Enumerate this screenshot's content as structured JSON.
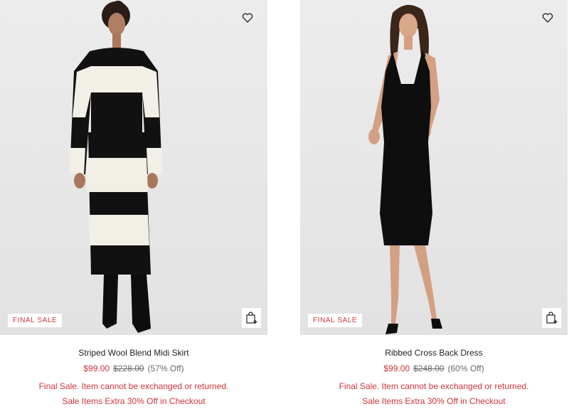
{
  "products": [
    {
      "name": "Striped Wool Blend Midi Skirt",
      "badge": "FINAL SALE",
      "sale_price": "$99.00",
      "original_price": "$228.00",
      "discount": "(57% Off)",
      "final_sale_note": "Final Sale. Item cannot be exchanged or returned.",
      "promo_note": "Sale Items Extra 30% Off in Checkout",
      "wishlist_icon": "heart-icon",
      "quick_add_icon": "shopping-bag-plus-icon"
    },
    {
      "name": "Ribbed Cross Back Dress",
      "badge": "FINAL SALE",
      "sale_price": "$99.00",
      "original_price": "$248.00",
      "discount": "(60% Off)",
      "final_sale_note": "Final Sale. Item cannot be exchanged or returned.",
      "promo_note": "Sale Items Extra 30% Off in Checkout",
      "wishlist_icon": "heart-icon",
      "quick_add_icon": "shopping-bag-plus-icon"
    }
  ],
  "colors": {
    "sale": "#d0343a",
    "text": "#222222",
    "muted": "#6a6a6a",
    "image_bg": "#e8e8e8"
  }
}
